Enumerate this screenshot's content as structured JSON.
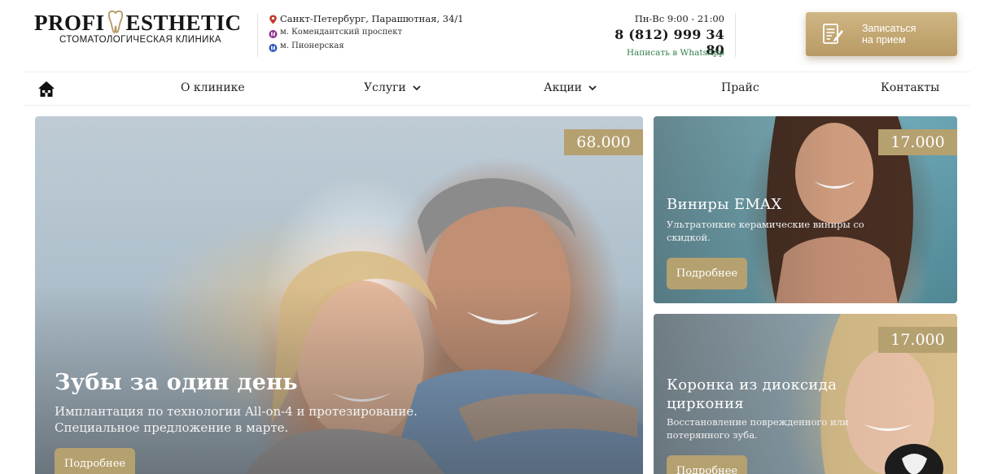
{
  "header": {
    "logo": {
      "left": "PROFI",
      "right": "ESTHETIC",
      "subtitle": "СТОМАТОЛОГИЧЕСКАЯ КЛИНИКА"
    },
    "address": "Санкт-Петербург, Парашютная, 34/1",
    "metro": [
      "м. Комендантский проспект",
      "м. Пионерская"
    ],
    "hours": "Пн-Вс 9:00 - 21:00",
    "phone": "8 (812) 999 34 80",
    "whatsapp": "Написать в WhatsApp",
    "cta_line1": "Записаться",
    "cta_line2": "на прием"
  },
  "nav": {
    "items": [
      {
        "label": "О клинике"
      },
      {
        "label": "Услуги"
      },
      {
        "label": "Акции"
      },
      {
        "label": "Прайс"
      },
      {
        "label": "Контакты"
      }
    ]
  },
  "promos": {
    "hero": {
      "price": "68.000",
      "title": "Зубы за один день",
      "description": "Имплантация по технологии All-on-4 и протезирование. Специальное предложение в марте.",
      "button": "Подробнее"
    },
    "emax": {
      "price": "17.000",
      "title": "Виниры EMAX",
      "description": "Ультратонкие керамические виниры со скидкой.",
      "button": "Подробнее"
    },
    "zirconia": {
      "price": "17.000",
      "title": "Коронка из диоксида циркония",
      "description": "Восстановление поврежденного или потерянного зуба.",
      "button": "Подробнее"
    }
  },
  "colors": {
    "gold": "#b5a06f",
    "cta_gold": "#c6ab77",
    "whatsapp_green": "#2e7d4a",
    "pin_red": "#c0392b",
    "metro_purple": "#8e2c8c",
    "metro_blue": "#2b55b8"
  },
  "icons": [
    "map-pin-icon",
    "metro-icon",
    "appointment-form-icon",
    "home-icon",
    "chevron-down-icon",
    "tooth-logo-icon"
  ]
}
